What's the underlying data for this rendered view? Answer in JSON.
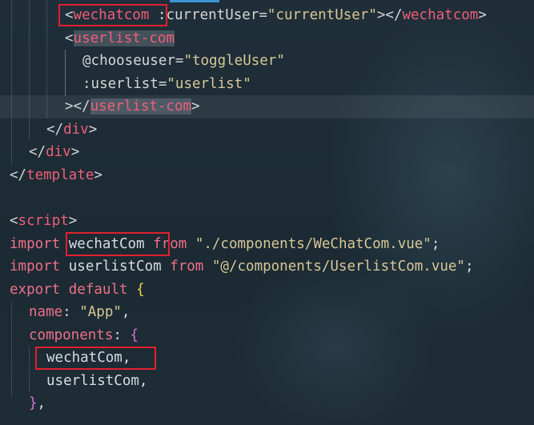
{
  "lines": [
    {
      "id": "l1",
      "tokens": [
        {
          "t": "<",
          "c": "t-punc"
        },
        {
          "t": "wechatcom",
          "c": "t-tag"
        },
        {
          "t": " ",
          "c": "t-punc"
        },
        {
          "t": ":currentUser",
          "c": "t-attr"
        },
        {
          "t": "=",
          "c": "t-punc"
        },
        {
          "t": "\"currentUser\"",
          "c": "t-str"
        },
        {
          "t": "></",
          "c": "t-punc"
        },
        {
          "t": "wechatcom",
          "c": "t-tag"
        },
        {
          "t": ">",
          "c": "t-punc"
        }
      ]
    },
    {
      "id": "l2",
      "tokens": [
        {
          "t": "<",
          "c": "t-punc"
        },
        {
          "t": "userlist-com",
          "c": "t-tag",
          "hl": true
        }
      ]
    },
    {
      "id": "l3",
      "tokens": [
        {
          "t": "@chooseuser",
          "c": "t-attr"
        },
        {
          "t": "=",
          "c": "t-punc"
        },
        {
          "t": "\"toggleUser\"",
          "c": "t-str"
        }
      ]
    },
    {
      "id": "l4",
      "tokens": [
        {
          "t": ":userlist",
          "c": "t-attr"
        },
        {
          "t": "=",
          "c": "t-punc"
        },
        {
          "t": "\"userlist\"",
          "c": "t-str"
        }
      ]
    },
    {
      "id": "l5",
      "tokens": [
        {
          "t": "></",
          "c": "t-punc"
        },
        {
          "t": "userlist-com",
          "c": "t-tag",
          "hl": true
        },
        {
          "t": ">",
          "c": "t-punc"
        }
      ]
    },
    {
      "id": "l6",
      "tokens": [
        {
          "t": "</",
          "c": "t-punc"
        },
        {
          "t": "div",
          "c": "t-tag"
        },
        {
          "t": ">",
          "c": "t-punc"
        }
      ]
    },
    {
      "id": "l7",
      "tokens": [
        {
          "t": "</",
          "c": "t-punc"
        },
        {
          "t": "div",
          "c": "t-tag"
        },
        {
          "t": ">",
          "c": "t-punc"
        }
      ]
    },
    {
      "id": "l8",
      "tokens": [
        {
          "t": "</",
          "c": "t-punc"
        },
        {
          "t": "template",
          "c": "t-tag"
        },
        {
          "t": ">",
          "c": "t-punc"
        }
      ]
    },
    {
      "id": "l9",
      "tokens": []
    },
    {
      "id": "l10",
      "tokens": [
        {
          "t": "<",
          "c": "t-punc"
        },
        {
          "t": "script",
          "c": "t-tag"
        },
        {
          "t": ">",
          "c": "t-punc"
        }
      ]
    },
    {
      "id": "l11",
      "tokens": [
        {
          "t": "import",
          "c": "t-kw"
        },
        {
          "t": " wechatCom ",
          "c": "t-plain"
        },
        {
          "t": "from",
          "c": "t-kw"
        },
        {
          "t": " ",
          "c": "t-plain"
        },
        {
          "t": "\"./components/WeChatCom.vue\"",
          "c": "t-str"
        },
        {
          "t": ";",
          "c": "t-plain"
        }
      ]
    },
    {
      "id": "l12",
      "tokens": [
        {
          "t": "import",
          "c": "t-kw"
        },
        {
          "t": " userlistCom ",
          "c": "t-plain"
        },
        {
          "t": "from",
          "c": "t-kw"
        },
        {
          "t": " ",
          "c": "t-plain"
        },
        {
          "t": "\"@/components/UserlistCom.vue\"",
          "c": "t-str"
        },
        {
          "t": ";",
          "c": "t-plain"
        }
      ]
    },
    {
      "id": "l13",
      "tokens": [
        {
          "t": "export",
          "c": "t-kw"
        },
        {
          "t": " ",
          "c": "t-plain"
        },
        {
          "t": "default",
          "c": "t-kw"
        },
        {
          "t": " ",
          "c": "t-plain"
        },
        {
          "t": "{",
          "c": "t-brace"
        }
      ]
    },
    {
      "id": "l14",
      "tokens": [
        {
          "t": "name",
          "c": "t-kw"
        },
        {
          "t": ": ",
          "c": "t-plain"
        },
        {
          "t": "\"App\"",
          "c": "t-str"
        },
        {
          "t": ",",
          "c": "t-plain"
        }
      ]
    },
    {
      "id": "l15",
      "tokens": [
        {
          "t": "components",
          "c": "t-kw"
        },
        {
          "t": ": ",
          "c": "t-plain"
        },
        {
          "t": "{",
          "c": "t-brace2"
        }
      ]
    },
    {
      "id": "l16",
      "tokens": [
        {
          "t": "wechatCom",
          "c": "t-plain"
        },
        {
          "t": ",",
          "c": "t-plain"
        }
      ]
    },
    {
      "id": "l17",
      "tokens": [
        {
          "t": "userlistCom",
          "c": "t-plain"
        },
        {
          "t": ",",
          "c": "t-plain"
        }
      ]
    },
    {
      "id": "l18",
      "tokens": [
        {
          "t": "}",
          "c": "t-brace2"
        },
        {
          "t": ",",
          "c": "t-plain"
        }
      ]
    }
  ]
}
